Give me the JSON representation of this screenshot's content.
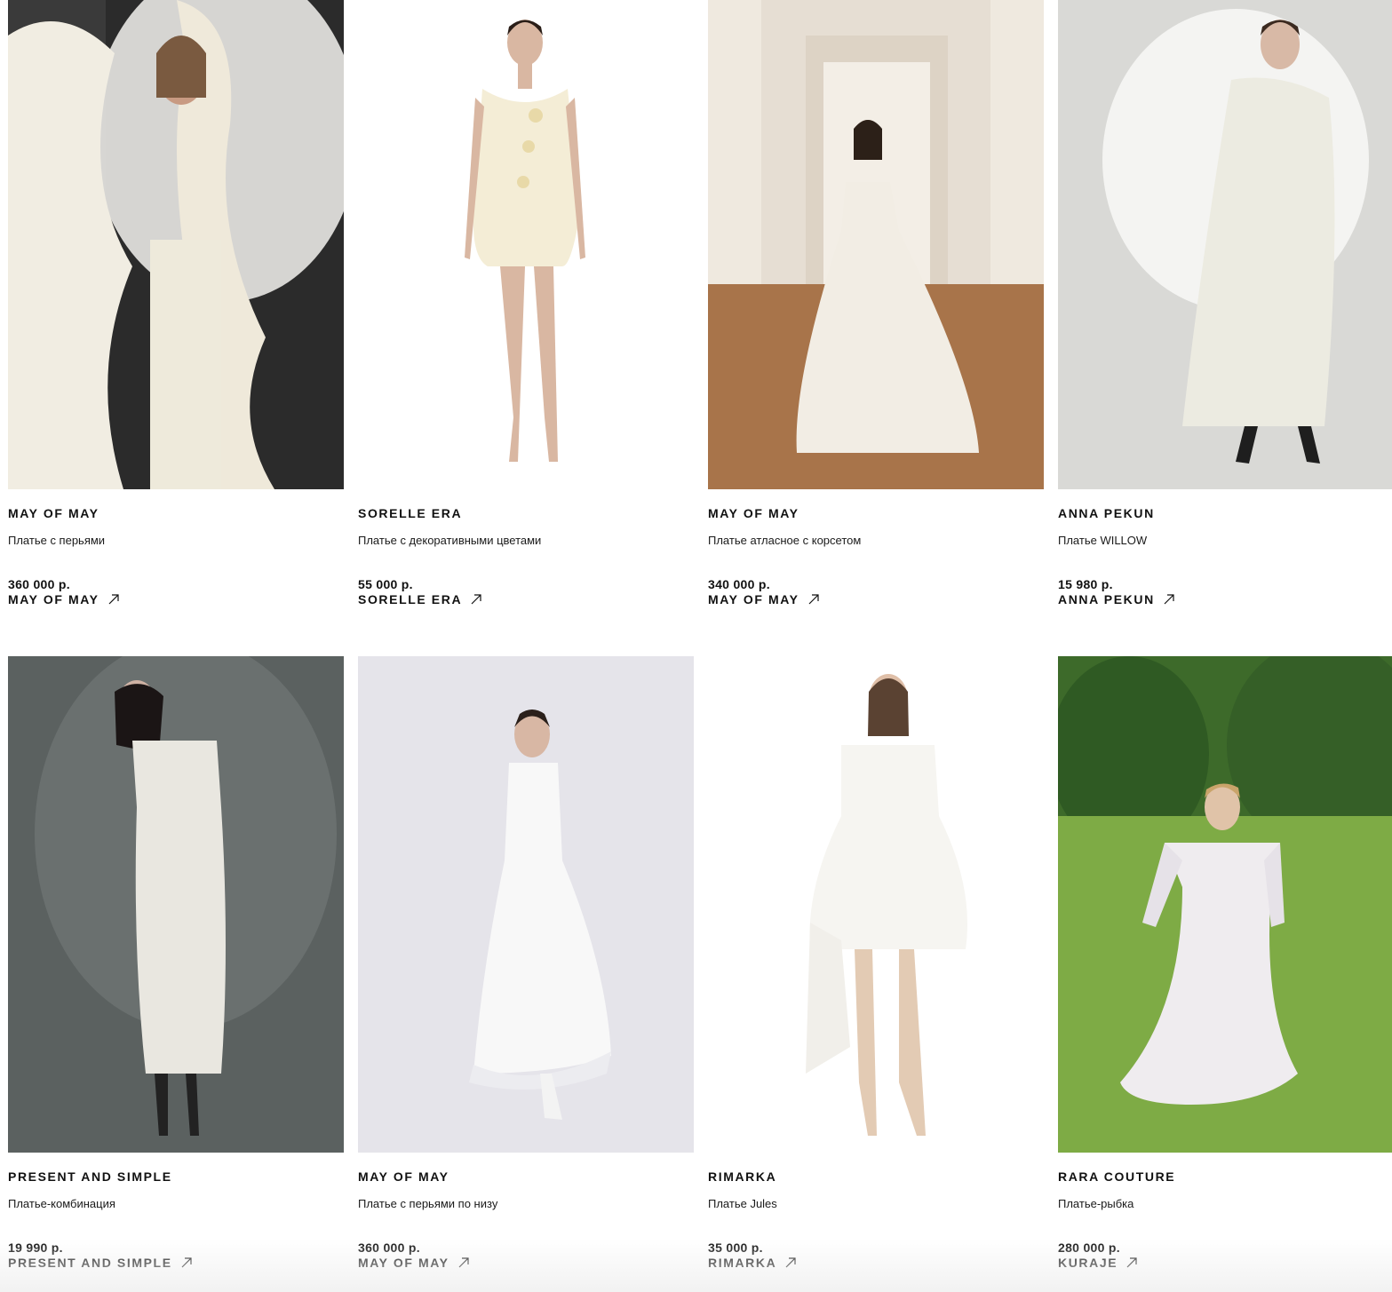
{
  "products": [
    {
      "brand": "MAY OF MAY",
      "description": "Платье с перьями",
      "price": "360 000 р.",
      "shop": "MAY OF MAY",
      "photo_colors": {
        "bg": "#2b2b2b",
        "dress": "#eeeadb",
        "accent": "#f3efe2"
      }
    },
    {
      "brand": "SORELLE ERA",
      "description": "Платье с декоративными цветами",
      "price": "55 000 р.",
      "shop": "SORELLE ERA",
      "photo_colors": {
        "bg": "#ffffff",
        "dress": "#f4edd6",
        "accent": "#e8d9a8"
      }
    },
    {
      "brand": "MAY OF MAY",
      "description": "Платье атласное с корсетом",
      "price": "340 000 р.",
      "shop": "MAY OF MAY",
      "photo_colors": {
        "bg": "#e6ded3",
        "dress": "#f2ede4",
        "accent": "#a8744a"
      }
    },
    {
      "brand": "ANNA PEKUN",
      "description": "Платье WILLOW",
      "price": "15 980 р.",
      "shop": "ANNA PEKUN",
      "photo_colors": {
        "bg": "#d9d9d6",
        "dress": "#ecebe1",
        "accent": "#f4f4f2"
      }
    },
    {
      "brand": "PRESENT AND SIMPLE",
      "description": "Платье-комбинация",
      "price": "19 990 р.",
      "shop": "PRESENT AND SIMPLE",
      "photo_colors": {
        "bg": "#5b6160",
        "dress": "#e9e7e0",
        "accent": "#4a4f4e"
      }
    },
    {
      "brand": "MAY OF MAY",
      "description": "Платье с перьями по низу",
      "price": "360 000 р.",
      "shop": "MAY OF MAY",
      "photo_colors": {
        "bg": "#e5e4ea",
        "dress": "#f8f8f8",
        "accent": "#dadae2"
      }
    },
    {
      "brand": "RIMARKA",
      "description": "Платье Jules",
      "price": "35 000 р.",
      "shop": "RIMARKA",
      "photo_colors": {
        "bg": "#ffffff",
        "dress": "#f6f5f1",
        "accent": "#e3cbb4"
      }
    },
    {
      "brand": "RARA COUTURE",
      "description": "Платье-рыбка",
      "price": "280 000 р.",
      "shop": "KURAJE",
      "photo_colors": {
        "bg": "#6f9a3b",
        "dress": "#efecef",
        "accent": "#2f5a23"
      }
    }
  ],
  "icons": {
    "link": "arrow-up-right-icon"
  }
}
